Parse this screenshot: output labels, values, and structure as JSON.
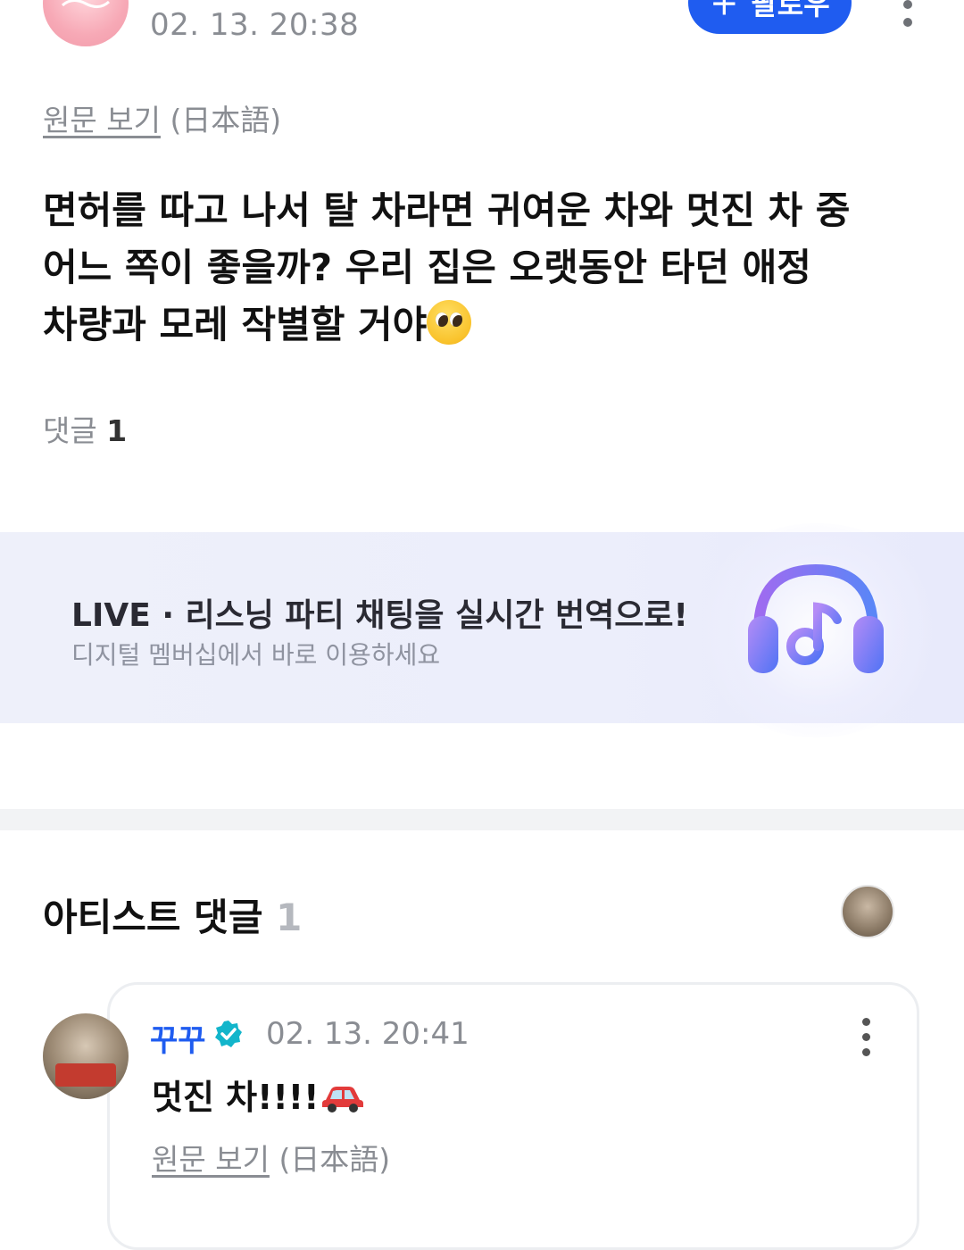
{
  "post": {
    "time": "02. 13. 20:38",
    "follow_label": "팔로우",
    "view_original": "원문 보기",
    "original_lang": "(日本語)",
    "body_line1": "면허를 따고 나서 탈 차라면 귀여운 차와 멋진 차 중",
    "body_line2": "어느 쪽이 좋을까? 우리 집은 오랫동안 타던 애정",
    "body_line3": "차량과 모레 작별할 거야",
    "comment_label": "댓글",
    "comment_count": "1"
  },
  "banner": {
    "title": "LIVE · 리스닝 파티 채팅을 실시간 번역으로!",
    "subtitle": "디지털 멤버십에서 바로 이용하세요",
    "icon": "headphones-music-icon"
  },
  "artist_comments": {
    "title": "아티스트 댓글",
    "count": "1"
  },
  "comment": {
    "author": "꾸꾸",
    "time": "02. 13. 20:41",
    "text": "멋진 차!!!!",
    "view_original": "원문 보기",
    "original_lang": "(日本語)"
  },
  "colors": {
    "accent": "#1f5cf0",
    "verified": "#12b5cb",
    "muted_text": "#8a8d93"
  }
}
